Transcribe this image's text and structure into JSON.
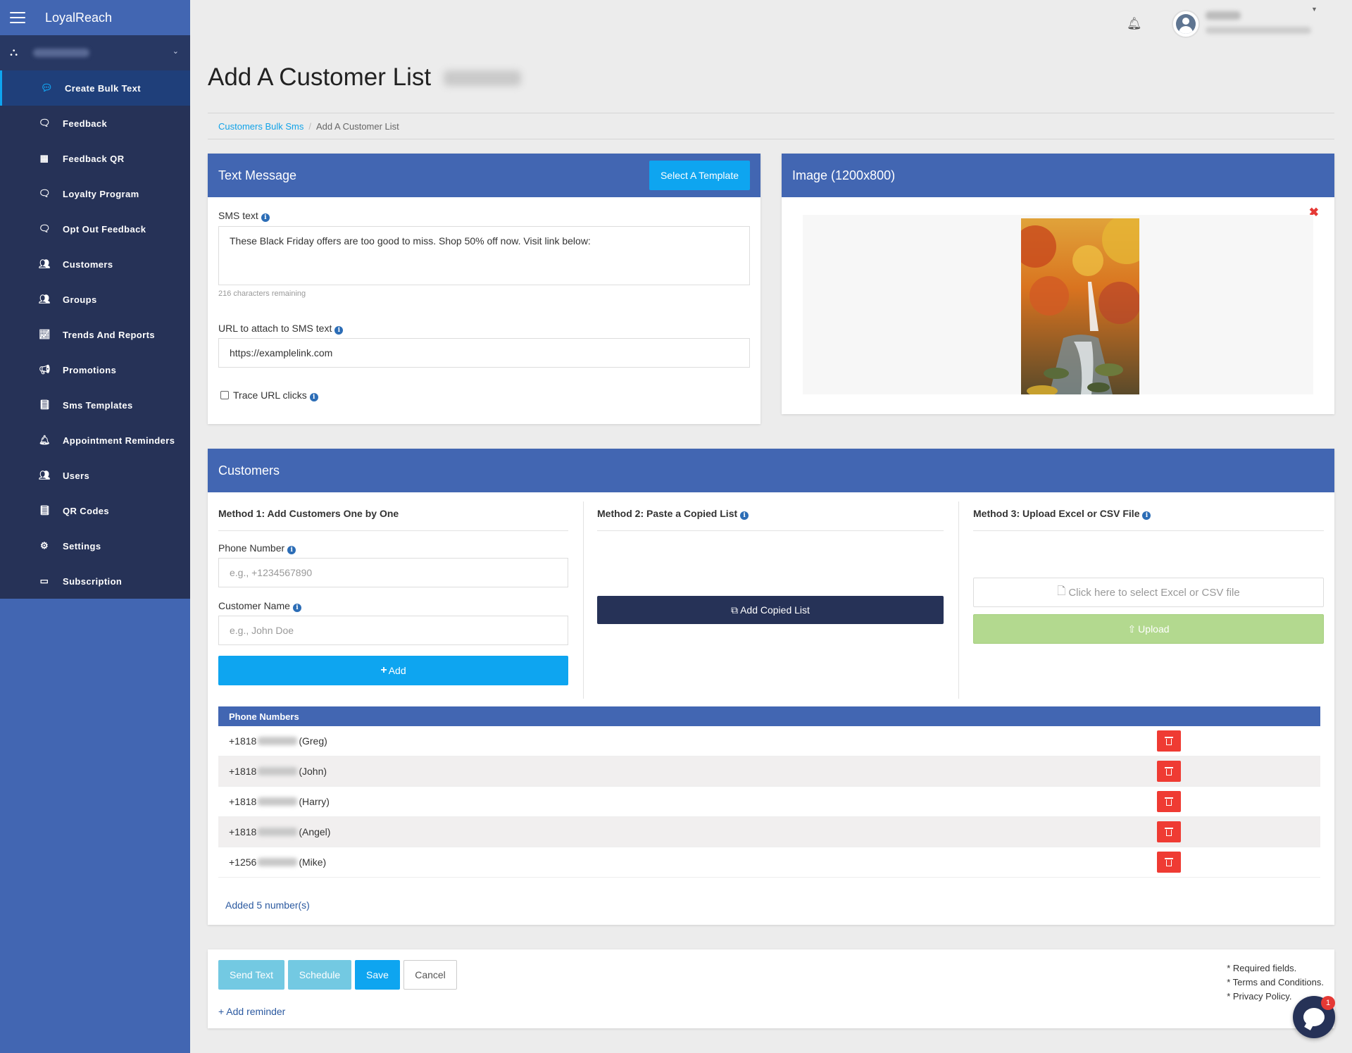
{
  "app": {
    "brand": "LoyalReach"
  },
  "sidebar": {
    "items": [
      {
        "label": "Create Bulk Text",
        "icon": "chat-icon"
      },
      {
        "label": "Feedback",
        "icon": "comments-icon"
      },
      {
        "label": "Feedback QR",
        "icon": "qrcode-icon"
      },
      {
        "label": "Loyalty Program",
        "icon": "comments-icon"
      },
      {
        "label": "Opt Out Feedback",
        "icon": "comments-icon"
      },
      {
        "label": "Customers",
        "icon": "users-icon"
      },
      {
        "label": "Groups",
        "icon": "users-icon"
      },
      {
        "label": "Trends And Reports",
        "icon": "line-chart-icon"
      },
      {
        "label": "Promotions",
        "icon": "bullhorn-icon"
      },
      {
        "label": "Sms Templates",
        "icon": "book-icon"
      },
      {
        "label": "Appointment Reminders",
        "icon": "bell-icon"
      },
      {
        "label": "Users",
        "icon": "users-icon"
      },
      {
        "label": "QR Codes",
        "icon": "book-icon"
      },
      {
        "label": "Settings",
        "icon": "gear-icon"
      },
      {
        "label": "Subscription",
        "icon": "credit-card-icon"
      }
    ]
  },
  "page": {
    "title": "Add A Customer List"
  },
  "breadcrumb": {
    "parent": "Customers Bulk Sms",
    "current": "Add A Customer List"
  },
  "text_message": {
    "heading": "Text Message",
    "template_button": "Select A Template",
    "sms_label": "SMS text",
    "sms_value": "These Black Friday offers are too good to miss. Shop 50% off now. Visit link below:",
    "remaining": "216 characters remaining",
    "url_label": "URL to attach to SMS text",
    "url_value": "https://examplelink.com",
    "trace_label": "Trace URL clicks"
  },
  "image_panel": {
    "heading": "Image (1200x800)"
  },
  "customers": {
    "heading": "Customers",
    "method1": {
      "title": "Method 1: Add Customers One by One",
      "phone_label": "Phone Number",
      "phone_placeholder": "e.g., +1234567890",
      "name_label": "Customer Name",
      "name_placeholder": "e.g., John Doe",
      "add_button": "Add"
    },
    "method2": {
      "title": "Method 2: Paste a Copied List",
      "button": "Add Copied List"
    },
    "method3": {
      "title": "Method 3: Upload Excel or CSV File",
      "file_button": "Click here to select Excel or CSV file",
      "upload_button": "Upload"
    },
    "table_header": "Phone Numbers",
    "numbers": [
      {
        "prefix": "+1818",
        "name": "(Greg)"
      },
      {
        "prefix": "+1818",
        "name": "(John)"
      },
      {
        "prefix": "+1818",
        "name": "(Harry)"
      },
      {
        "prefix": "+1818",
        "name": "(Angel)"
      },
      {
        "prefix": "+1256",
        "name": "(Mike)"
      }
    ],
    "added_count": "Added 5 number(s)"
  },
  "actions": {
    "send": "Send Text",
    "schedule": "Schedule",
    "save": "Save",
    "cancel": "Cancel",
    "add_reminder": "+ Add reminder",
    "notes": [
      "* Required fields.",
      "* Terms and Conditions.",
      "* Privacy Policy."
    ]
  },
  "chat": {
    "badge": "1"
  },
  "colors": {
    "primary": "#4266b2",
    "accent": "#0ea5f0",
    "sidebar": "#263257",
    "danger": "#ef3b33",
    "upload": "#b3d98f"
  }
}
